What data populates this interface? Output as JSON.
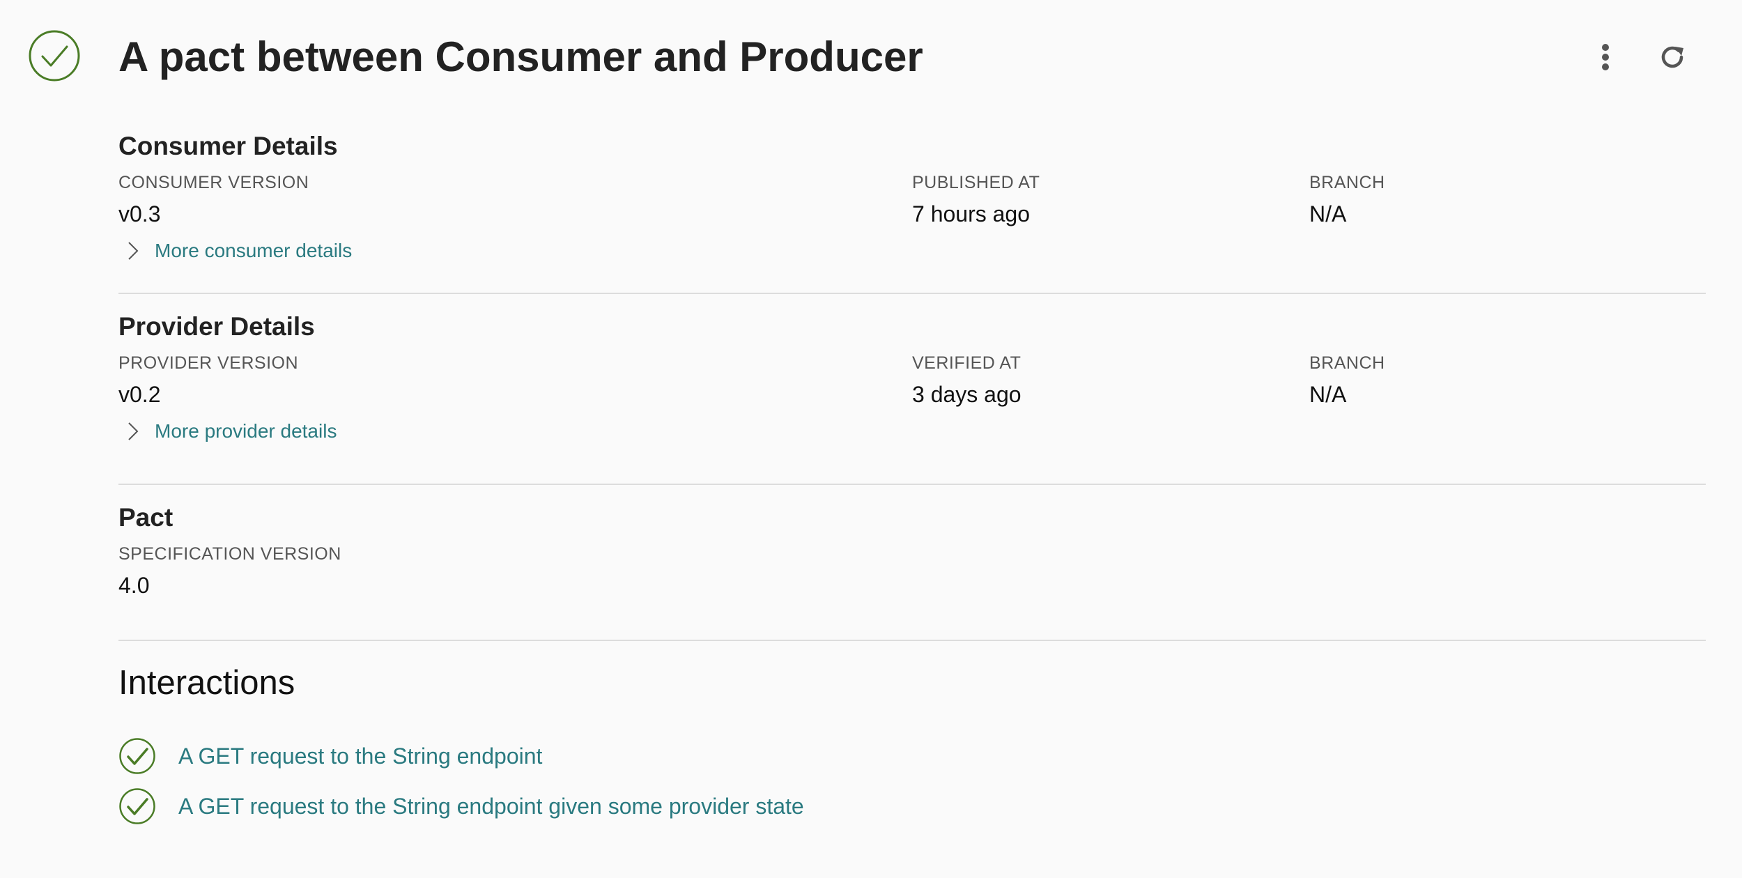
{
  "header": {
    "title": "A pact between Consumer and Producer",
    "status_icon": "check-circle-icon",
    "menu_icon": "more-vertical-icon",
    "refresh_icon": "refresh-icon"
  },
  "consumer": {
    "title": "Consumer Details",
    "version_label": "CONSUMER VERSION",
    "version": "v0.3",
    "published_label": "PUBLISHED AT",
    "published": "7 hours ago",
    "branch_label": "BRANCH",
    "branch": "N/A",
    "more_label": "More consumer details"
  },
  "provider": {
    "title": "Provider Details",
    "version_label": "PROVIDER VERSION",
    "version": "v0.2",
    "verified_label": "VERIFIED AT",
    "verified": "3 days ago",
    "branch_label": "BRANCH",
    "branch": "N/A",
    "more_label": "More provider details"
  },
  "pact": {
    "title": "Pact",
    "spec_label": "SPECIFICATION VERSION",
    "spec": "4.0"
  },
  "interactions": {
    "title": "Interactions",
    "items": [
      {
        "label": "A GET request to the String endpoint",
        "status": "passed"
      },
      {
        "label": "A GET request to the String endpoint given some provider state",
        "status": "passed"
      }
    ]
  },
  "colors": {
    "success": "#4a7c26",
    "link": "#2a7a80",
    "divider": "#dcdcdc",
    "background": "#fafafa"
  }
}
